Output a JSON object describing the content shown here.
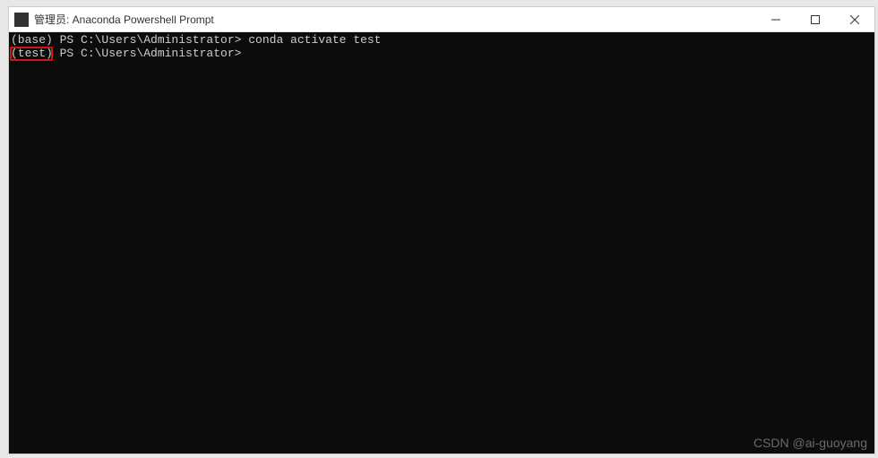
{
  "window": {
    "title": "管理员: Anaconda Powershell Prompt"
  },
  "terminal": {
    "lines": [
      {
        "prefix": "(base) PS C:\\Users\\Administrator> ",
        "command": "conda activate test"
      },
      {
        "prefix": "(test) PS C:\\Users\\Administrator> ",
        "command": ""
      }
    ]
  },
  "watermark": "CSDN @ai-guoyang"
}
